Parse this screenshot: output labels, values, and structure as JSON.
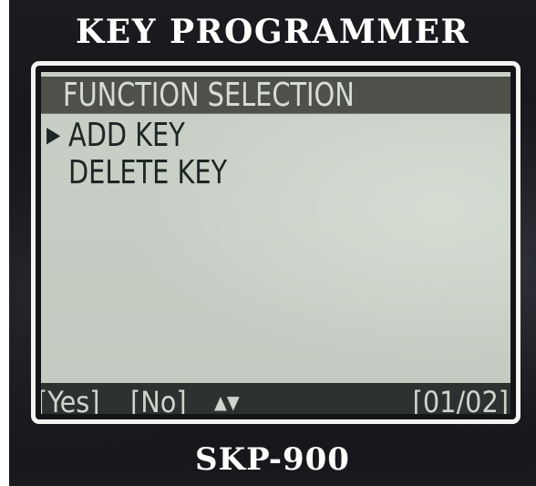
{
  "device": {
    "brand_title": "KEY PROGRAMMER",
    "model": "SKP-900"
  },
  "screen": {
    "header": "FUNCTION SELECTION",
    "cursor_symbol": "▶",
    "selected_index": 0,
    "menu_items": [
      {
        "label": "ADD KEY"
      },
      {
        "label": "DELETE KEY"
      }
    ],
    "footer": {
      "yes_label": "[Yes]",
      "no_label": "[No]",
      "nav_symbol": "▲▼",
      "page_indicator": "[01/02]"
    }
  },
  "colors": {
    "device_body": "#141518",
    "lcd_background": "#c6ccc3",
    "header_bar": "#4e514a",
    "footer_bar": "#2d3230",
    "text_dark": "#1c2624",
    "text_light": "#d8ddd4"
  }
}
